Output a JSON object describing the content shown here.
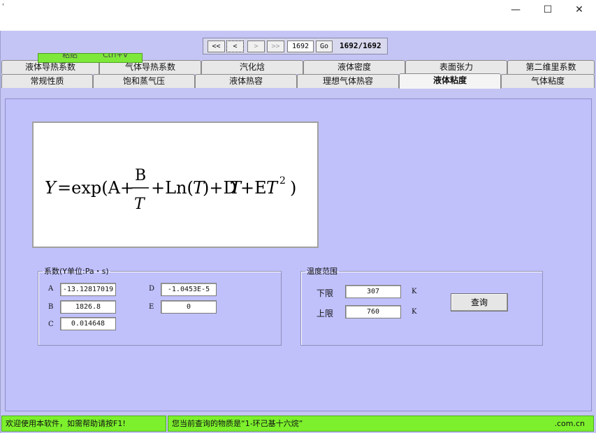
{
  "window": {
    "tick": "'",
    "minimize": "—",
    "maximize": "☐",
    "close": "✕"
  },
  "nav": {
    "first": "<<",
    "prev": "<",
    "next": ">",
    "last": ">>",
    "record": "1692",
    "go": "Go",
    "count": "1692/1692"
  },
  "context_menu": {
    "item": "粘贴",
    "shortcut": "Ctrl+V"
  },
  "tabs_row1": [
    "液体导热系数",
    "气体导热系数",
    "汽化焓",
    "液体密度",
    "表面张力",
    "第二维里系数"
  ],
  "tabs_row2": [
    "常规性质",
    "饱和蒸气压",
    "液体热容",
    "理想气体热容",
    "液体粘度",
    "气体粘度"
  ],
  "formula": {
    "Y": "Y",
    "eq": "=exp(A+",
    "B": "B",
    "T": "T",
    "plus_ln": "+Ln(",
    "close_plus": ")+D",
    "plus_e": "+E",
    "sq": "2",
    "end": ")"
  },
  "coefficients": {
    "legend": "系数(Y单位:Pa・s)",
    "A_label": "A",
    "A": "-13.12817019",
    "B_label": "B",
    "B": "1826.8",
    "C_label": "C",
    "C": "0.014648",
    "D_label": "D",
    "D": "-1.0453E-5",
    "E_label": "E",
    "E": "0"
  },
  "temperature": {
    "legend": "温度范围",
    "lower_label": "下限",
    "lower": "307",
    "lower_unit": "K",
    "upper_label": "上限",
    "upper": "760",
    "upper_unit": "K",
    "query": "查询"
  },
  "status": {
    "left": "欢迎使用本软件，如需帮助请按F1!",
    "middle": "您当前查询的物质是“1-环己基十六烷”",
    "right": ".com.cn"
  }
}
